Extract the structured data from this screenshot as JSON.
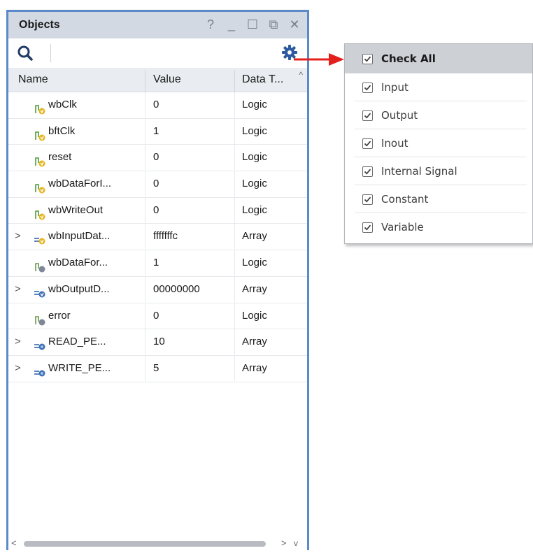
{
  "panel": {
    "title": "Objects",
    "controls": [
      {
        "name": "help-icon",
        "glyph": "?"
      },
      {
        "name": "minimize-icon",
        "glyph": "_"
      },
      {
        "name": "maximize-icon",
        "glyph": "☐"
      },
      {
        "name": "float-icon",
        "glyph": "⧉"
      },
      {
        "name": "close-icon",
        "glyph": "✕"
      }
    ]
  },
  "table": {
    "headers": {
      "name": "Name",
      "value": "Value",
      "type": "Data T..."
    },
    "rows": [
      {
        "expand": "",
        "icon": "input-signal-icon",
        "name": "wbClk",
        "value": "0",
        "type": "Logic"
      },
      {
        "expand": "",
        "icon": "input-signal-icon",
        "name": "bftClk",
        "value": "1",
        "type": "Logic"
      },
      {
        "expand": "",
        "icon": "input-signal-icon",
        "name": "reset",
        "value": "0",
        "type": "Logic"
      },
      {
        "expand": "",
        "icon": "input-signal-icon",
        "name": "wbDataForI...",
        "value": "0",
        "type": "Logic"
      },
      {
        "expand": "",
        "icon": "input-signal-icon",
        "name": "wbWriteOut",
        "value": "0",
        "type": "Logic"
      },
      {
        "expand": ">",
        "icon": "input-array-icon",
        "name": "wbInputDat...",
        "value": "fffffffc",
        "type": "Array"
      },
      {
        "expand": "",
        "icon": "output-signal-icon",
        "name": "wbDataFor...",
        "value": "1",
        "type": "Logic"
      },
      {
        "expand": ">",
        "icon": "output-array-icon",
        "name": "wbOutputD...",
        "value": "00000000",
        "type": "Array"
      },
      {
        "expand": "",
        "icon": "output-signal-icon",
        "name": "error",
        "value": "0",
        "type": "Logic"
      },
      {
        "expand": ">",
        "icon": "constant-array-icon",
        "name": "READ_PE...",
        "value": "10",
        "type": "Array"
      },
      {
        "expand": ">",
        "icon": "constant-array-icon",
        "name": "WRITE_PE...",
        "value": "5",
        "type": "Array"
      }
    ]
  },
  "filter_menu": {
    "items": [
      {
        "label": "Check All",
        "checked": true
      },
      {
        "label": "Input",
        "checked": true
      },
      {
        "label": "Output",
        "checked": true
      },
      {
        "label": "Inout",
        "checked": true
      },
      {
        "label": "Internal Signal",
        "checked": true
      },
      {
        "label": "Constant",
        "checked": true
      },
      {
        "label": "Variable",
        "checked": true
      }
    ]
  },
  "colors": {
    "panel_border": "#5b89c9",
    "titlebar": "#d3d9e3",
    "gear": "#2c5aa0",
    "callout_arrow": "#e3201b"
  }
}
